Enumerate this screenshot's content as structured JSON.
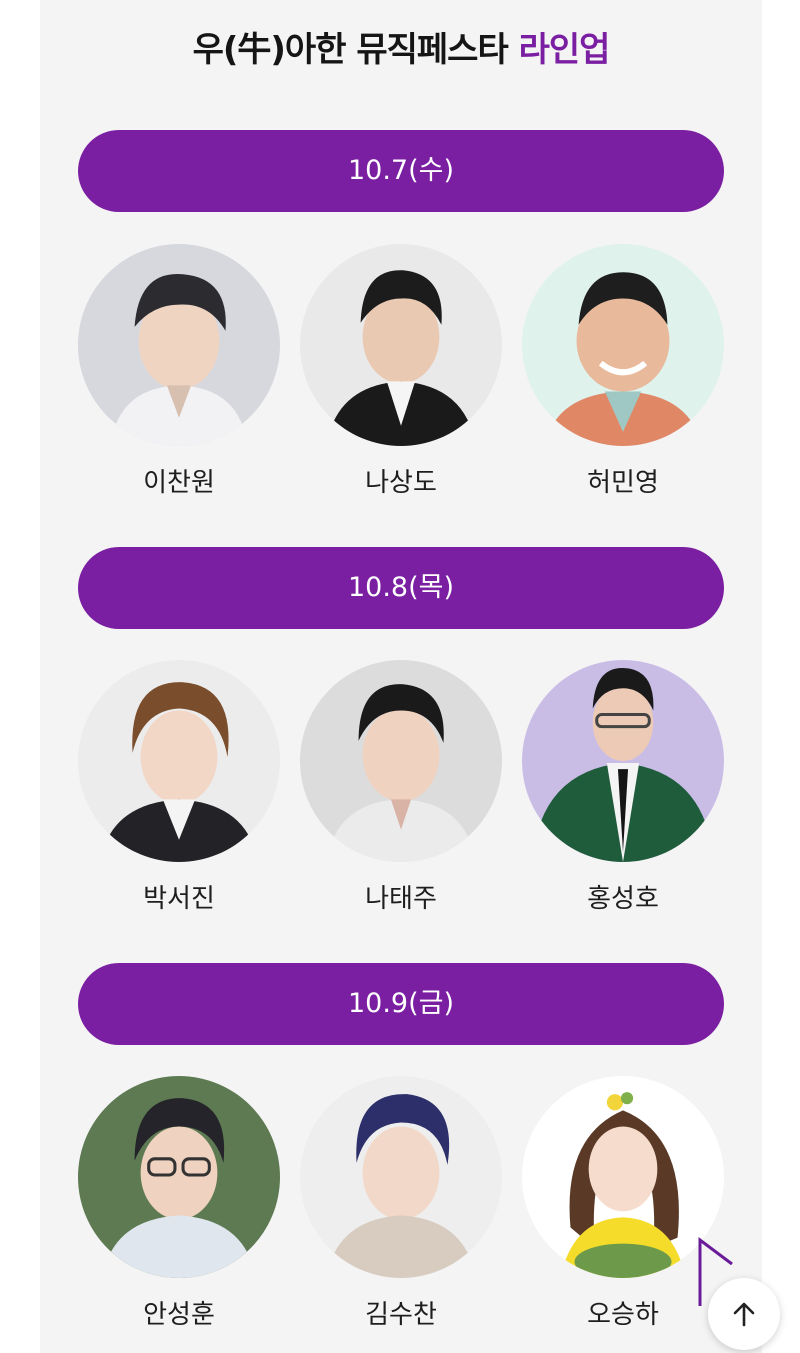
{
  "header": {
    "title_main": "우(牛)아한 뮤직페스타",
    "title_accent": "라인업"
  },
  "colors": {
    "accent": "#7b1fa2",
    "background": "#f4f4f4"
  },
  "days": [
    {
      "date": "10.7(수)",
      "artists": [
        {
          "name": "이찬원",
          "bg": "#d6d8de"
        },
        {
          "name": "나상도",
          "bg": "#e9e9e9"
        },
        {
          "name": "허민영",
          "bg": "#dff2ec"
        }
      ]
    },
    {
      "date": "10.8(목)",
      "artists": [
        {
          "name": "박서진",
          "bg": "#ececec"
        },
        {
          "name": "나태주",
          "bg": "#dcdcdc"
        },
        {
          "name": "홍성호",
          "bg": "#c9bde6"
        }
      ]
    },
    {
      "date": "10.9(금)",
      "artists": [
        {
          "name": "안성훈",
          "bg": "#5e7a52"
        },
        {
          "name": "김수찬",
          "bg": "#eeeeee"
        },
        {
          "name": "오승하",
          "bg": "#ffffff"
        }
      ]
    }
  ],
  "scroll_top": {
    "icon": "arrow-up-icon"
  }
}
